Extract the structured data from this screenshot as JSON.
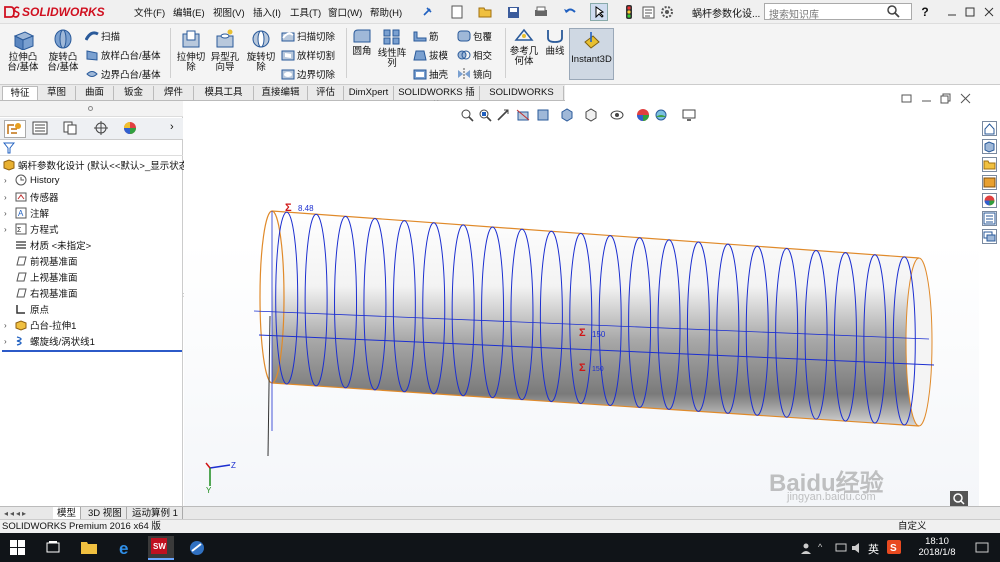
{
  "app": {
    "brand": "SOLIDWORKS",
    "doc_title": "蜗杆参数化设..."
  },
  "menu": [
    "文件(F)",
    "编辑(E)",
    "视图(V)",
    "插入(I)",
    "工具(T)",
    "窗口(W)",
    "帮助(H)"
  ],
  "search": {
    "placeholder": "搜索知识库"
  },
  "ribbon": {
    "extrude_boss": "拉伸凸\n台/基体",
    "revolve_boss": "旋转凸\n台/基体",
    "sweep": "扫描",
    "loft_boss": "放样凸台/基体",
    "boundary_boss": "边界凸台/基体",
    "extrude_cut": "拉伸切\n除",
    "hole_wizard": "异型孔\n向导",
    "revolve_cut": "旋转切\n除",
    "sweep_cut": "扫描切除",
    "loft_cut": "放样切割",
    "boundary_cut": "边界切除",
    "fillet": "圆角",
    "linear_pattern": "线性阵\n列",
    "rib": "筋",
    "draft": "拔模",
    "shell": "抽壳",
    "wrap": "包覆",
    "intersect": "相交",
    "mirror": "镜向",
    "ref_geometry": "参考几\n何体",
    "curves": "曲线",
    "instant3d": "Instant3D"
  },
  "tabs": [
    "特征",
    "草图",
    "曲面",
    "钣金",
    "焊件",
    "模具工具",
    "直接编辑",
    "评估",
    "DimXpert",
    "SOLIDWORKS 插件",
    "SOLIDWORKS MBD"
  ],
  "tree": {
    "root": "蜗杆参数化设计 (默认<<默认>_显示状态",
    "items": [
      {
        "label": "History"
      },
      {
        "label": "传感器"
      },
      {
        "label": "注解"
      },
      {
        "label": "方程式"
      },
      {
        "label": "材质 <未指定>"
      },
      {
        "label": "前视基准面"
      },
      {
        "label": "上视基准面"
      },
      {
        "label": "右视基准面"
      },
      {
        "label": "原点"
      },
      {
        "label": "凸台-拉伸1"
      },
      {
        "label": "螺旋线/涡状线1"
      }
    ]
  },
  "viewport": {
    "dim_pitch": "8.48",
    "dim_length": "150",
    "dim_length2": "150",
    "triad_z": "Z",
    "triad_y": "Y"
  },
  "bottom_tabs": [
    "模型",
    "3D 视图",
    "运动算例 1"
  ],
  "status": "SOLIDWORKS Premium 2016 x64 版",
  "status_right": "自定义",
  "taskbar": {
    "ime": "英",
    "time": "18:10",
    "date": "2018/1/8"
  },
  "watermark": {
    "brand": "Baidu经验",
    "url": "jingyan.baidu.com"
  },
  "colors": {
    "helix": "#1c2fd0",
    "edge": "#e08a2a",
    "dim": "#d01515",
    "brand": "#d01020"
  }
}
